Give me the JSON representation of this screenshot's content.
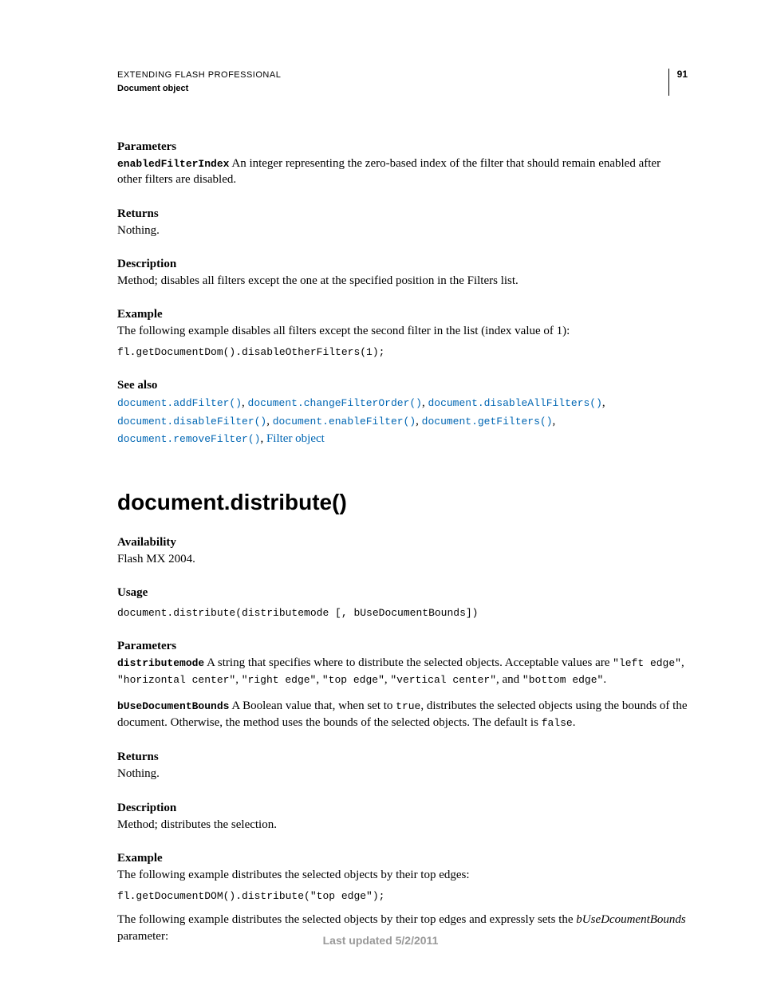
{
  "header": {
    "title": "EXTENDING FLASH PROFESSIONAL",
    "subtitle": "Document object",
    "page_number": "91"
  },
  "section1": {
    "parameters_label": "Parameters",
    "param1_name": "enabledFilterIndex",
    "param1_desc_a": " An integer representing the zero-based index of the filter that should remain enabled after other filters are disabled.",
    "returns_label": "Returns",
    "returns_text": "Nothing.",
    "description_label": "Description",
    "description_text": "Method; disables all filters except the one at the specified position in the Filters list.",
    "example_label": "Example",
    "example_intro": "The following example disables all filters except the second filter in the list (index value of 1):",
    "example_code": "fl.getDocumentDom().disableOtherFilters(1);",
    "seealso_label": "See also",
    "seealso_links": {
      "l1": "document.addFilter()",
      "l2": "document.changeFilterOrder()",
      "l3": "document.disableAllFilters()",
      "l4": "document.disableFilter()",
      "l5": "document.enableFilter()",
      "l6": "document.getFilters()",
      "l7": "document.removeFilter()",
      "l8": "Filter object"
    }
  },
  "section2": {
    "title": "document.distribute()",
    "availability_label": "Availability",
    "availability_text": "Flash MX 2004.",
    "usage_label": "Usage",
    "usage_code": "document.distribute(distributemode [, bUseDocumentBounds])",
    "parameters_label": "Parameters",
    "param1_name": "distributemode",
    "param1_desc_a": " A string that specifies where to distribute the selected objects. Acceptable values are ",
    "param1_lit1": "\"left edge\"",
    "param1_lit2": "\"horizontal center\"",
    "param1_lit3": "\"right edge\"",
    "param1_lit4": "\"top edge\"",
    "param1_lit5": "\"vertical center\"",
    "param1_and": ", and ",
    "param1_lit6": "\"bottom edge\"",
    "param2_name": "bUseDocumentBounds",
    "param2_desc_a": " A Boolean value that, when set to ",
    "param2_true": "true",
    "param2_desc_b": ", distributes the selected objects using the bounds of the document. Otherwise, the method uses the bounds of the selected objects. The default is ",
    "param2_false": "false",
    "returns_label": "Returns",
    "returns_text": "Nothing.",
    "description_label": "Description",
    "description_text": "Method; distributes the selection.",
    "example_label": "Example",
    "example_intro1": "The following example distributes the selected objects by their top edges:",
    "example_code1": "fl.getDocumentDOM().distribute(\"top edge\");",
    "example_intro2_a": "The following example distributes the selected objects by their top edges and expressly sets the ",
    "example_intro2_i": "bUseDcoumentBounds",
    "example_intro2_b": " parameter:"
  },
  "footer": {
    "text": "Last updated 5/2/2011"
  }
}
